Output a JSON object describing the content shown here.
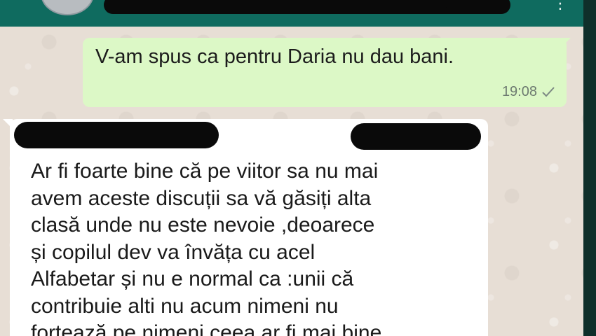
{
  "header": {
    "menu_icon": "⋮"
  },
  "messages": {
    "outgoing": {
      "text": "V-am spus ca pentru Daria nu dau bani.",
      "time": "19:08",
      "status_icon": "check-icon"
    },
    "incoming": {
      "text": "Ar fi foarte bine că pe viitor sa nu mai\navem aceste discuții sa vă găsiți alta\nclasă unde nu este nevoie ,deoarece\nși copilul dev va învăța cu acel\nAlfabetar și nu e normal ca :unii că\ncontribuie alti nu acum nimeni nu\nforțează pe nimeni ceea ar fi mai bine"
    }
  },
  "colors": {
    "header": "#0f6b5f",
    "outgoing_bubble": "#dcf8c6",
    "incoming_bubble": "#ffffff",
    "wallpaper": "#e7ded5"
  }
}
